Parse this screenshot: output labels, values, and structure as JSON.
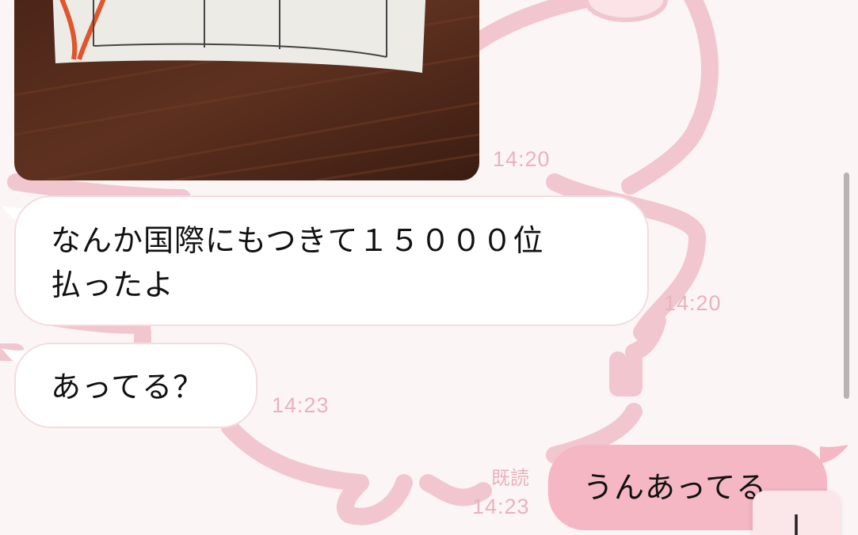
{
  "messages": [
    {
      "type": "image",
      "time": "14:20"
    },
    {
      "type": "text",
      "direction": "incoming",
      "lines": [
        "なんか国際にもつきて１５０００位",
        "払ったよ"
      ],
      "time": "14:20"
    },
    {
      "type": "text",
      "direction": "incoming",
      "text": "あってる？",
      "time": "14:23"
    },
    {
      "type": "text",
      "direction": "outgoing",
      "text": "うんあってる",
      "read_label": "既読",
      "time": "14:23"
    }
  ],
  "colors": {
    "background": "#fcf5f5",
    "incoming_bubble": "#ffffff",
    "outgoing_bubble": "#f4b7c3",
    "timestamp": "#e7b3bd"
  },
  "controls": {
    "scroll_down_icon": "arrow-down-icon"
  }
}
